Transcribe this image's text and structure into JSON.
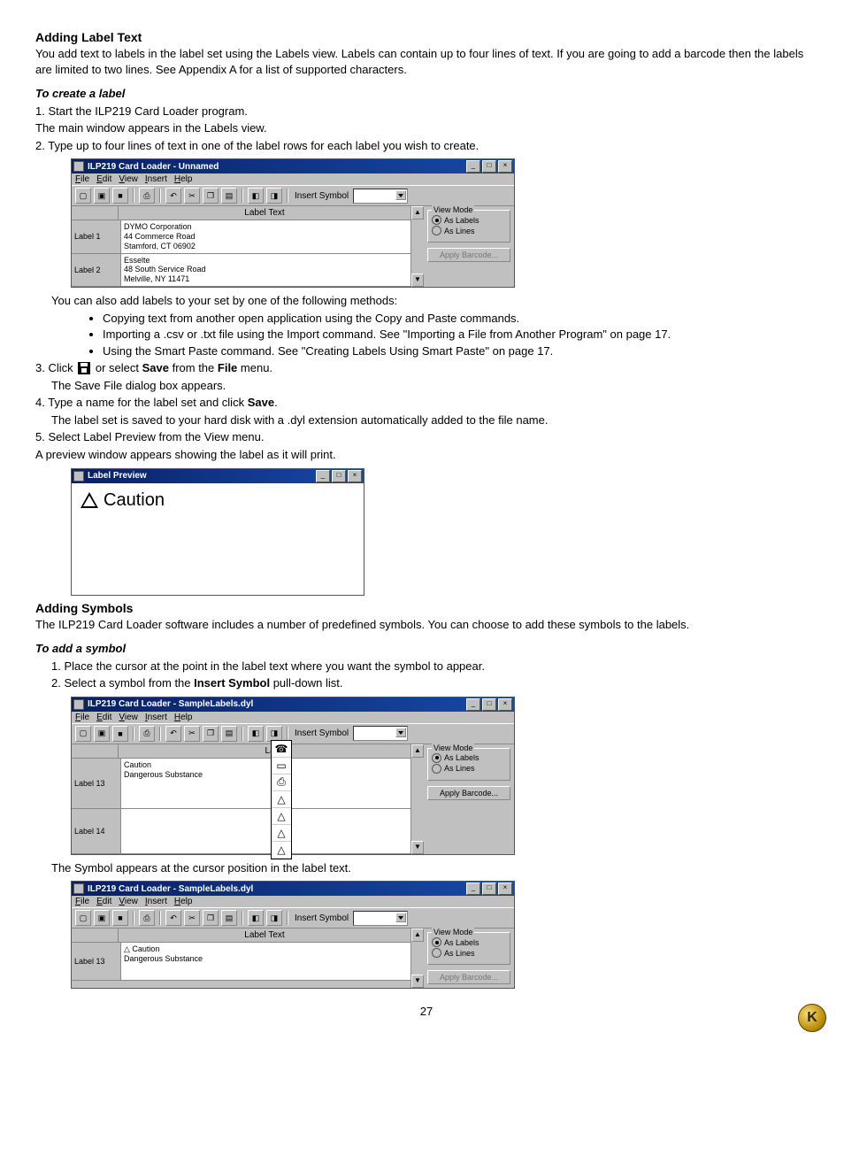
{
  "section1": {
    "heading": "Adding Label Text",
    "para": "You add text to labels in the label set using the Labels view. Labels can contain up to four lines of text. If you are going to add a barcode then the labels are limited to two lines. See Appendix A for a list of supported characters.",
    "subhead": "To create a label",
    "step1": "1. Start the ILP219 Card Loader program.",
    "step1b": "The main window appears in the Labels view.",
    "step2": "2. Type up to four lines of text in one of the label rows for each label you wish to create."
  },
  "win1": {
    "title": "ILP219 Card Loader - Unnamed",
    "menu": [
      "File",
      "Edit",
      "View",
      "Insert",
      "Help"
    ],
    "insert_symbol": "Insert Symbol",
    "col_header": "Label Text",
    "rows": [
      {
        "name": "Label 1",
        "text": "DYMO Corporation\n44 Commerce Road\nStamford, CT 06902"
      },
      {
        "name": "Label 2",
        "text": "Esselte\n48 South Service Road\nMelville, NY 11471"
      }
    ],
    "view_mode": "View Mode",
    "as_labels": "As Labels",
    "as_lines": "As Lines",
    "apply_barcode": "Apply Barcode..."
  },
  "after1": {
    "intro": "You can also add labels to your set by one of the following methods:",
    "bullets": [
      "Copying text from another open application using the Copy and Paste commands.",
      "Importing a .csv or .txt file using the Import command. See \"Importing a File from Another Program\" on page 17.",
      "Using the Smart Paste command. See \"Creating Labels Using Smart Paste\" on page 17."
    ],
    "step3a": "3. Click ",
    "step3b": " or select ",
    "step3_save": "Save",
    "step3c": " from the ",
    "step3_file": "File",
    "step3d": " menu.",
    "step3_after": "The Save File dialog box appears.",
    "step4a": "4. Type a name for the label set and click ",
    "step4_save": "Save",
    "step4b": ".",
    "step4_after": "The label set is saved to your hard disk with a .dyl extension automatically added to the file name.",
    "step5": "5. Select Label Preview from the View menu.",
    "step5_after": "A preview window appears showing the label as it will print."
  },
  "previewwin": {
    "title": "Label Preview",
    "text": "Caution"
  },
  "section2": {
    "heading": "Adding Symbols",
    "para": "The ILP219 Card Loader software includes a number of predefined symbols. You can choose to add these symbols to the labels.",
    "subhead": "To add a symbol",
    "step1": "1. Place the cursor at the point in the label text where you want the symbol to appear.",
    "step2a": "2. Select a symbol from the ",
    "step2_bold": "Insert Symbol",
    "step2b": " pull-down list."
  },
  "win2": {
    "title": "ILP219 Card Loader - SampleLabels.dyl",
    "col_header": "Label",
    "rows": [
      {
        "name": "Label 13",
        "text": "Caution\nDangerous Substance"
      },
      {
        "name": "Label 14",
        "text": ""
      }
    ],
    "apply_barcode": "Apply Barcode..."
  },
  "symbols": [
    "☎",
    "▭",
    "⎙",
    "△",
    "△",
    "△",
    "△"
  ],
  "after2": "The Symbol appears at the cursor position in the label text.",
  "win3": {
    "title": "ILP219 Card Loader - SampleLabels.dyl",
    "col_header": "Label Text",
    "rows": [
      {
        "name": "Label 13",
        "text": "△ Caution\nDangerous Substance"
      }
    ]
  },
  "page_number": "27"
}
